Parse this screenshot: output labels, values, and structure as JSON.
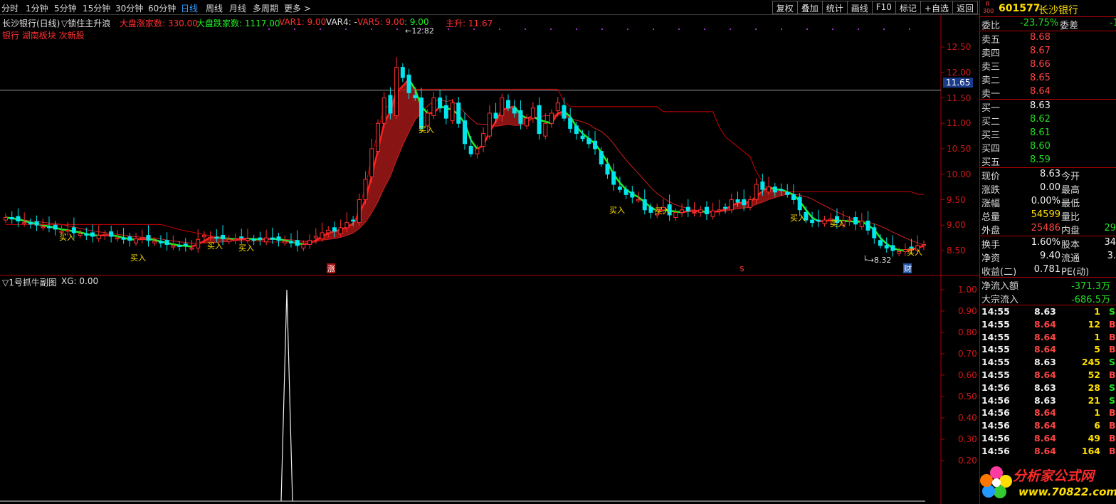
{
  "toolbar": {
    "periods": [
      "分时",
      "1分钟",
      "5分钟",
      "15分钟",
      "30分钟",
      "60分钟",
      "日线",
      "周线",
      "月线",
      "多周期",
      "更多 >"
    ],
    "active_period": "日线",
    "buttons": [
      "复权",
      "叠加",
      "统计",
      "画线",
      "F10",
      "标记",
      "+自选",
      "返回"
    ]
  },
  "main_chart": {
    "title": "长沙银行(日线)",
    "indicator": "▽锁住主升浪",
    "dapan_up_label": "大盘涨家数: 330.00",
    "dapan_down_label": "大盘跌家数: 1117.00",
    "var1": "VAR1: 9.00",
    "var4": "VAR4: -",
    "var5": "VAR5: 9.00",
    "var_extra": ": 9.00",
    "main_rise": "主升: 11.67",
    "tags": "银行 湖南板块 次新股",
    "high_label": "12.82",
    "low_label": "8.32",
    "current_price_tag": "11.65",
    "buy_label": "买入",
    "markers": {
      "zhang": "涨",
      "dollar": "$",
      "cai": "财"
    },
    "y_axis": [
      {
        "value": 12.5,
        "label": "12.50"
      },
      {
        "value": 12.0,
        "label": "12.00"
      },
      {
        "value": 11.5,
        "label": "11.50"
      },
      {
        "value": 11.0,
        "label": "11.00"
      },
      {
        "value": 10.5,
        "label": "10.50"
      },
      {
        "value": 10.0,
        "label": "10.00"
      },
      {
        "value": 9.5,
        "label": "9.50"
      },
      {
        "value": 9.0,
        "label": "9.00"
      },
      {
        "value": 8.5,
        "label": "8.50"
      }
    ]
  },
  "sub_chart": {
    "title": "▽1号抓牛副图",
    "xg": "XG: 0.00",
    "y_axis": [
      "1.00",
      "0.90",
      "0.80",
      "0.70",
      "0.60",
      "0.50",
      "0.40",
      "0.30",
      "0.20"
    ]
  },
  "chart_data": {
    "type": "candlestick",
    "title": "长沙银行(日线)",
    "price_axis_range": [
      8.2,
      12.9
    ],
    "support_line": 11.65,
    "period_high": 12.82,
    "period_low": 8.32,
    "signal_series": {
      "name": "XG",
      "current": 0.0,
      "peak": 1.0,
      "range": [
        0,
        1
      ]
    },
    "closes": [
      9.15,
      9.12,
      9.08,
      9.05,
      9.02,
      9.0,
      8.97,
      8.95,
      8.92,
      8.88,
      8.9,
      8.85,
      8.83,
      8.8,
      8.78,
      8.8,
      8.82,
      8.78,
      8.75,
      8.72,
      8.7,
      8.73,
      8.75,
      8.7,
      8.68,
      8.65,
      8.62,
      8.6,
      8.58,
      8.6,
      8.55,
      8.72,
      8.8,
      8.76,
      8.75,
      8.73,
      8.72,
      8.72,
      8.75,
      8.73,
      8.7,
      8.72,
      8.75,
      8.72,
      8.7,
      8.68,
      8.65,
      8.6,
      8.62,
      8.7,
      8.78,
      8.85,
      8.9,
      8.88,
      8.95,
      9.05,
      9.1,
      9.5,
      9.9,
      10.5,
      11.0,
      11.5,
      11.2,
      12.1,
      11.9,
      11.6,
      11.5,
      10.9,
      11.2,
      11.5,
      11.3,
      11.1,
      11.4,
      11.0,
      10.6,
      10.4,
      10.5,
      10.8,
      11.2,
      11.1,
      11.5,
      11.3,
      11.2,
      11.0,
      11.1,
      11.3,
      10.8,
      11.0,
      11.2,
      11.4,
      11.1,
      10.9,
      10.8,
      10.7,
      10.6,
      10.5,
      10.2,
      10.0,
      9.8,
      9.7,
      9.6,
      9.55,
      9.5,
      9.3,
      9.25,
      9.3,
      9.35,
      9.2,
      9.25,
      9.3,
      9.28,
      9.25,
      9.3,
      9.22,
      9.28,
      9.3,
      9.35,
      9.5,
      9.45,
      9.4,
      9.5,
      9.8,
      9.7,
      9.75,
      9.65,
      9.7,
      9.6,
      9.5,
      9.3,
      9.1,
      9.05,
      9.08,
      9.1,
      9.12,
      9.05,
      9.08,
      9.1,
      9.02,
      9.08,
      8.9,
      8.75,
      8.6,
      8.55,
      8.5,
      8.48,
      8.52,
      8.55,
      8.6,
      8.62
    ]
  },
  "sidebar": {
    "badge_r": "R",
    "badge_num": "300",
    "code": "601577",
    "name": "长沙银行",
    "weibi_label": "委比",
    "weibi_value": "-23.75%",
    "weicha_label": "委差",
    "weicha_value": "-1",
    "asks": [
      {
        "label": "卖五",
        "price": "8.68"
      },
      {
        "label": "卖四",
        "price": "8.67"
      },
      {
        "label": "卖三",
        "price": "8.66"
      },
      {
        "label": "卖二",
        "price": "8.65"
      },
      {
        "label": "卖一",
        "price": "8.64"
      }
    ],
    "bids": [
      {
        "label": "买一",
        "price": "8.63",
        "color": "white"
      },
      {
        "label": "买二",
        "price": "8.62",
        "color": "green"
      },
      {
        "label": "买三",
        "price": "8.61",
        "color": "green"
      },
      {
        "label": "买四",
        "price": "8.60",
        "color": "green"
      },
      {
        "label": "买五",
        "price": "8.59",
        "color": "green"
      }
    ],
    "stats": [
      {
        "l1": "现价",
        "v1": "8.63",
        "c1": "white",
        "l2": "今开",
        "v2": ""
      },
      {
        "l1": "涨跌",
        "v1": "0.00",
        "c1": "white",
        "l2": "最高",
        "v2": ""
      },
      {
        "l1": "涨幅",
        "v1": "0.00%",
        "c1": "white",
        "l2": "最低",
        "v2": ""
      },
      {
        "l1": "总量",
        "v1": "54599",
        "c1": "yellow",
        "l2": "量比",
        "v2": ""
      },
      {
        "l1": "外盘",
        "v1": "25486",
        "c1": "red",
        "l2": "内盘",
        "v2": "29"
      }
    ],
    "stats2": [
      {
        "l1": "换手",
        "v1": "1.60%",
        "l2": "股本",
        "v2": "34"
      },
      {
        "l1": "净资",
        "v1": "9.40",
        "l2": "流通",
        "v2": "3."
      },
      {
        "l1": "收益(二)",
        "v1": "0.781",
        "l2": "PE(动)",
        "v2": ""
      }
    ],
    "flow": [
      {
        "label": "净流入额",
        "value": "-371.3万"
      },
      {
        "label": "大宗流入",
        "value": "-686.5万"
      }
    ],
    "trades": [
      {
        "time": "14:55",
        "price": "8.63",
        "pc": "white",
        "vol": "1",
        "side": "S"
      },
      {
        "time": "14:55",
        "price": "8.64",
        "pc": "red",
        "vol": "12",
        "side": "B"
      },
      {
        "time": "14:55",
        "price": "8.64",
        "pc": "red",
        "vol": "1",
        "side": "B"
      },
      {
        "time": "14:55",
        "price": "8.64",
        "pc": "red",
        "vol": "5",
        "side": "B"
      },
      {
        "time": "14:55",
        "price": "8.63",
        "pc": "white",
        "vol": "245",
        "side": "S"
      },
      {
        "time": "14:55",
        "price": "8.64",
        "pc": "red",
        "vol": "52",
        "side": "B"
      },
      {
        "time": "14:56",
        "price": "8.63",
        "pc": "white",
        "vol": "28",
        "side": "S"
      },
      {
        "time": "14:56",
        "price": "8.63",
        "pc": "white",
        "vol": "21",
        "side": "S"
      },
      {
        "time": "14:56",
        "price": "8.64",
        "pc": "red",
        "vol": "1",
        "side": "B"
      },
      {
        "time": "14:56",
        "price": "8.64",
        "pc": "red",
        "vol": "6",
        "side": "B"
      },
      {
        "time": "14:56",
        "price": "8.64",
        "pc": "red",
        "vol": "49",
        "side": "B"
      },
      {
        "time": "14:56",
        "price": "8.64",
        "pc": "red",
        "vol": "164",
        "side": "B"
      }
    ],
    "watermark": "分析家公式网",
    "watermark_url": "www.70822.com"
  },
  "colors": {
    "bg": "#000000",
    "up": "#ff3030",
    "down": "#00e5ee",
    "ma_green": "#22ee22",
    "ma_red": "#ff2020",
    "band": "#cc0000",
    "grid_red": "#b00000"
  }
}
